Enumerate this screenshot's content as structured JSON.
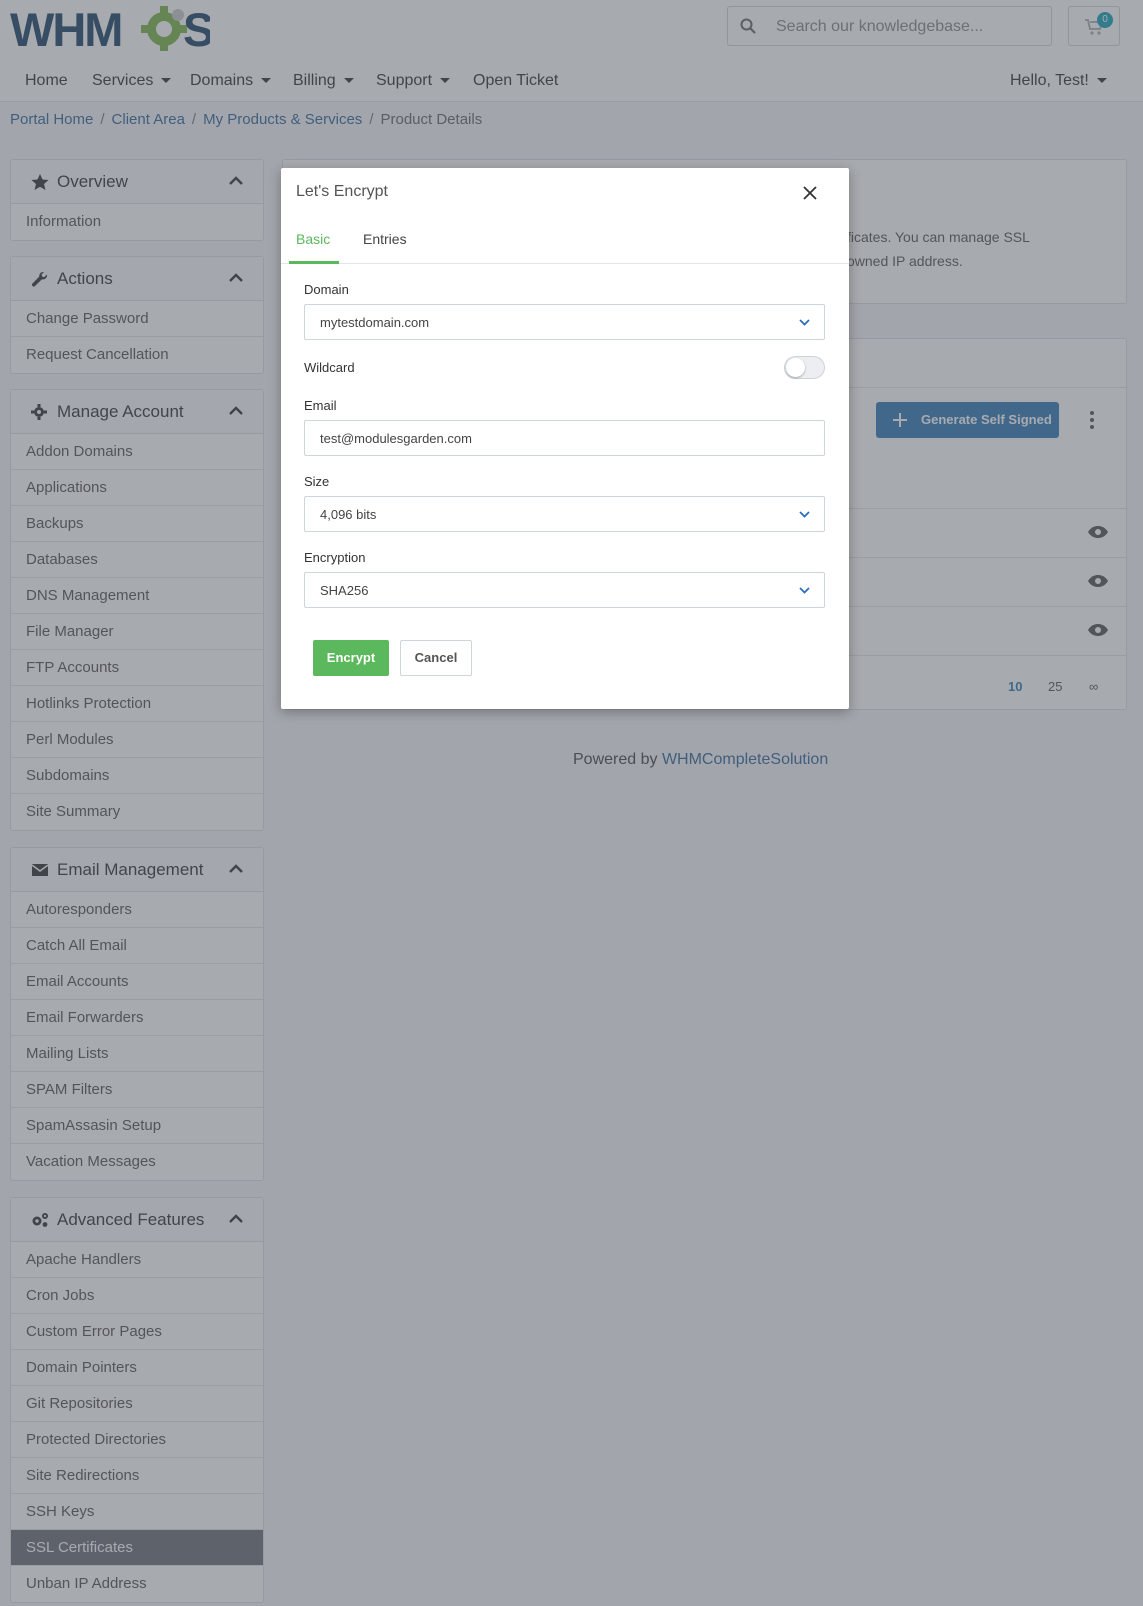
{
  "brand": {
    "logo_text_left": "WHM",
    "logo_text_right": "S",
    "gear_color": "#7ab648",
    "text_color": "#1d4466"
  },
  "header": {
    "search_placeholder": "Search our knowledgebase...",
    "cart_count": "0",
    "nav": [
      {
        "label": "Home",
        "dropdown": false
      },
      {
        "label": "Services",
        "dropdown": true
      },
      {
        "label": "Domains",
        "dropdown": true
      },
      {
        "label": "Billing",
        "dropdown": true
      },
      {
        "label": "Support",
        "dropdown": true
      },
      {
        "label": "Open Ticket",
        "dropdown": false
      }
    ],
    "user_greeting": "Hello, Test!"
  },
  "breadcrumb": {
    "items": [
      "Portal Home",
      "Client Area",
      "My Products & Services"
    ],
    "current": "Product Details"
  },
  "sidebar": {
    "overview": {
      "title": "Overview",
      "items": [
        "Information"
      ]
    },
    "actions": {
      "title": "Actions",
      "items": [
        "Change Password",
        "Request Cancellation"
      ]
    },
    "manage_account": {
      "title": "Manage Account",
      "items": [
        "Addon Domains",
        "Applications",
        "Backups",
        "Databases",
        "DNS Management",
        "File Manager",
        "FTP Accounts",
        "Hotlinks Protection",
        "Perl Modules",
        "Subdomains",
        "Site Summary"
      ]
    },
    "email_management": {
      "title": "Email Management",
      "items": [
        "Autoresponders",
        "Catch All Email",
        "Email Accounts",
        "Email Forwarders",
        "Mailing Lists",
        "SPAM Filters",
        "SpamAssasin Setup",
        "Vacation Messages"
      ]
    },
    "advanced_features": {
      "title": "Advanced Features",
      "items": [
        "Apache Handlers",
        "Cron Jobs",
        "Custom Error Pages",
        "Domain Pointers",
        "Git Repositories",
        "Protected Directories",
        "Site Redirections",
        "SSH Keys",
        "SSL Certificates",
        "Unban IP Address"
      ],
      "active": "SSL Certificates"
    }
  },
  "main": {
    "intro_line1": "ficates. You can manage SSL",
    "intro_line2": "owned IP address.",
    "generate_button": "Generate Self Signed",
    "pagination": [
      "10",
      "25",
      "∞"
    ],
    "footer_prefix": "Powered by ",
    "footer_link": "WHMCompleteSolution"
  },
  "modal": {
    "title": "Let's Encrypt",
    "tabs": [
      "Basic",
      "Entries"
    ],
    "domain_label": "Domain",
    "domain_value": "mytestdomain.com",
    "wildcard_label": "Wildcard",
    "wildcard_enabled": false,
    "email_label": "Email",
    "email_value": "test@modulesgarden.com",
    "size_label": "Size",
    "size_value": "4,096 bits",
    "encryption_label": "Encryption",
    "encryption_value": "SHA256",
    "encrypt_button": "Encrypt",
    "cancel_button": "Cancel",
    "accent_color": "#5cb85c"
  }
}
